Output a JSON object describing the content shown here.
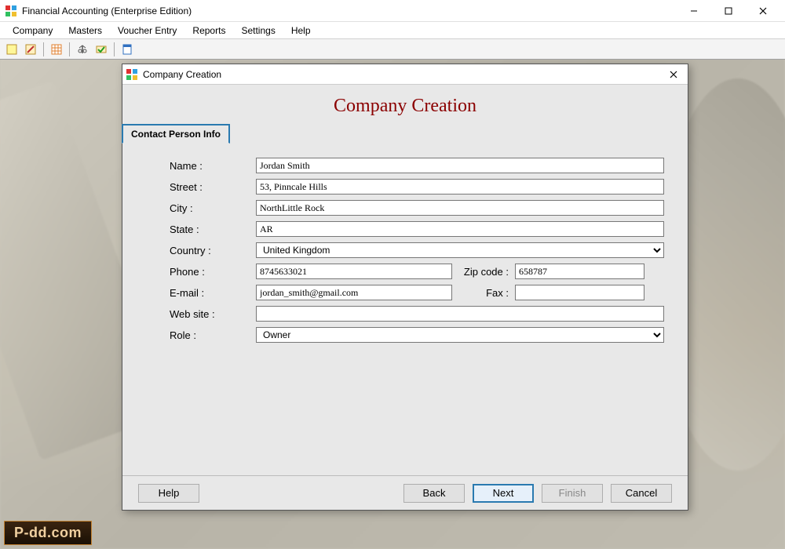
{
  "window": {
    "title": "Financial Accounting (Enterprise Edition)"
  },
  "menu": {
    "items": [
      "Company",
      "Masters",
      "Voucher Entry",
      "Reports",
      "Settings",
      "Help"
    ]
  },
  "dialog": {
    "title": "Company Creation",
    "heading": "Company Creation",
    "tab": "Contact Person Info",
    "labels": {
      "name": "Name :",
      "street": "Street :",
      "city": "City :",
      "state": "State :",
      "country": "Country :",
      "phone": "Phone :",
      "zip": "Zip code :",
      "email": "E-mail :",
      "fax": "Fax :",
      "website": "Web site :",
      "role": "Role :"
    },
    "values": {
      "name": "Jordan Smith",
      "street": "53, Pinncale Hills",
      "city": "NorthLittle Rock",
      "state": "AR",
      "country": "United Kingdom",
      "phone": "8745633021",
      "zip": "658787",
      "email": "jordan_smith@gmail.com",
      "fax": "",
      "website": "",
      "role": "Owner"
    },
    "buttons": {
      "help": "Help",
      "back": "Back",
      "next": "Next",
      "finish": "Finish",
      "cancel": "Cancel"
    }
  },
  "watermark": "P-dd.com"
}
